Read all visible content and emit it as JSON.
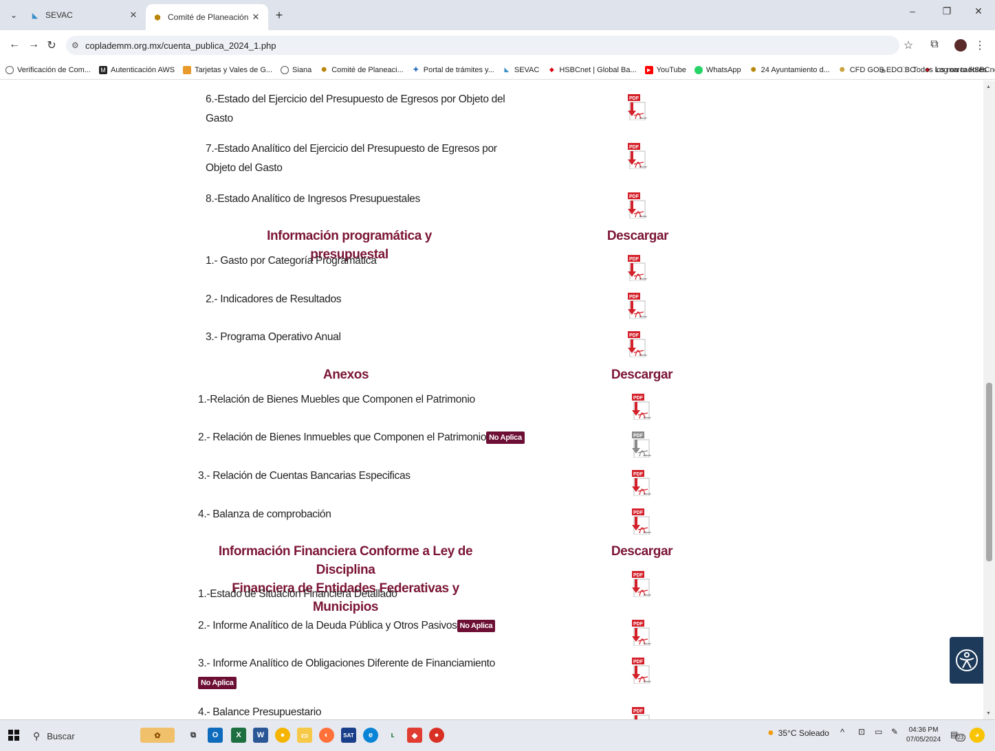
{
  "browser": {
    "tabs": [
      {
        "title": "SEVAC",
        "active": false
      },
      {
        "title": "Comité de Planeación para el D",
        "active": true
      }
    ],
    "url": "coplademm.org.mx/cuenta_publica_2024_1.php",
    "bookmarks": [
      "Verificación de Com...",
      "Autenticación AWS",
      "Tarjetas y Vales de G...",
      "Siana",
      "Comité de Planeaci...",
      "Portal de trámites y...",
      "SEVAC",
      "HSBCnet | Global Ba...",
      "YouTube",
      "WhatsApp",
      "24 Ayuntamiento d...",
      "CFD GOB EDO BC",
      "Log on to HSBCnet"
    ],
    "all_bookmarks": "Todos los marcadores",
    "overflow": "»"
  },
  "page": {
    "items_top": [
      {
        "line1": "6.-Estado del Ejercicio del Presupuesto de Egresos por Objeto del",
        "line2": "Gasto"
      },
      {
        "line1": "7.-Estado Analítico del Ejercicio del Presupuesto de Egresos por",
        "line2": "Objeto del Gasto"
      },
      {
        "line1": "8.-Estado Analítico de Ingresos Presupuestales",
        "line2": ""
      }
    ],
    "section_prog": {
      "title": "Información programática y presupuestal",
      "download": "Descargar",
      "items": [
        "1.- Gasto por Categoría Programática",
        "2.- Indicadores de Resultados",
        "3.- Programa Operativo Anual"
      ]
    },
    "section_anexos": {
      "title": "Anexos",
      "download": "Descargar",
      "items": [
        "1.-Relación de Bienes Muebles que Componen el Patrimonio",
        "2.- Relación de Bienes Inmuebles que Componen el Patrimonio",
        "3.- Relación de Cuentas Bancarias Especificas",
        "4.- Balanza de comprobación"
      ]
    },
    "section_ldf": {
      "title_line1": "Información Financiera Conforme a Ley de Disciplina",
      "title_line2": "Financiera de Entidades Federativas y Municipios",
      "download": "Descargar",
      "items": [
        "1.-Estado de Situación Financiera Detallado",
        "2.- Informe Analítico de la Deuda Pública y Otros Pasivos",
        "3.- Informe Analítico de Obligaciones Diferente de Financiamiento",
        "4.- Balance Presupuestario"
      ]
    },
    "no_aplica": "No Aplica",
    "pdf_label": "PDF",
    "adobe_label": "Adobe"
  },
  "taskbar": {
    "search": "Buscar",
    "weather": "35°C  Soleado",
    "time": "04:36 PM",
    "date": "07/05/2024",
    "notif_count": "23"
  },
  "colors": {
    "heading": "#7b1535",
    "badge": "#6d0f35",
    "pdf_red": "#d4202a"
  }
}
